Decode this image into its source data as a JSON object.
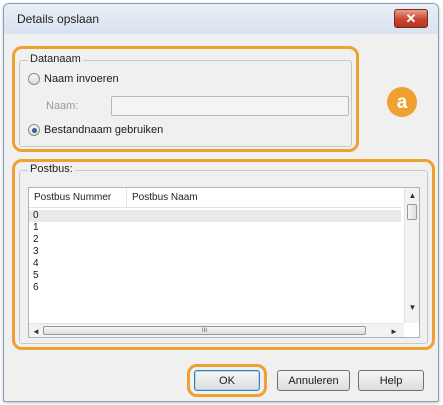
{
  "dialog": {
    "title": "Details opslaan",
    "close_glyph": "✕"
  },
  "callout": {
    "badge_label": "a",
    "accent_color": "#f0a030"
  },
  "file_name_group": {
    "title": "Datanaam",
    "radio_enter_name": {
      "label": "Naam invoeren",
      "checked": false
    },
    "name_field": {
      "label": "Naam:",
      "value": "",
      "enabled": false
    },
    "radio_use_file_name": {
      "label": "Bestandnaam gebruiken",
      "checked": true
    }
  },
  "mailbox_group": {
    "title": "Postbus:",
    "columns": [
      "Postbus Nummer",
      "Postbus Naam"
    ],
    "rows": [
      {
        "number": "0",
        "name": ""
      },
      {
        "number": "1",
        "name": ""
      },
      {
        "number": "2",
        "name": ""
      },
      {
        "number": "3",
        "name": ""
      },
      {
        "number": "4",
        "name": ""
      },
      {
        "number": "5",
        "name": ""
      },
      {
        "number": "6",
        "name": ""
      }
    ],
    "selected_row_index": 0,
    "scroll_up_glyph": "▲",
    "scroll_down_glyph": "▼",
    "scroll_left_glyph": "◄",
    "scroll_right_glyph": "►",
    "scroll_grip_glyph": "III"
  },
  "buttons": {
    "ok": "OK",
    "cancel": "Annuleren",
    "help": "Help"
  }
}
